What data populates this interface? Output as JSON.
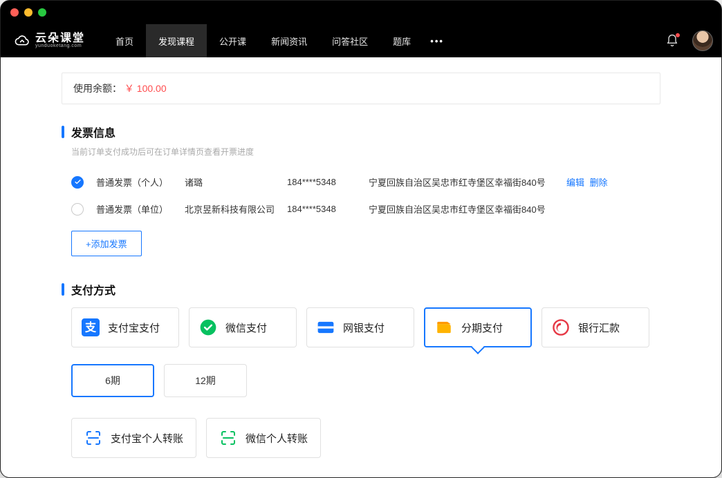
{
  "brand": {
    "name": "云朵课堂",
    "domain": "yunduoketang.com"
  },
  "nav": {
    "items": [
      {
        "label": "首页",
        "active": false
      },
      {
        "label": "发现课程",
        "active": true
      },
      {
        "label": "公开课",
        "active": false
      },
      {
        "label": "新闻资讯",
        "active": false
      },
      {
        "label": "问答社区",
        "active": false
      },
      {
        "label": "题库",
        "active": false
      }
    ]
  },
  "balance": {
    "label": "使用余额：",
    "value": "￥ 100.00"
  },
  "invoice": {
    "title": "发票信息",
    "sub": "当前订单支付成功后可在订单详情页查看开票进度",
    "rows": [
      {
        "type": "普通发票（个人）",
        "name": "诸璐",
        "phone": "184****5348",
        "addr": "宁夏回族自治区吴忠市红寺堡区幸福街840号",
        "checked": true,
        "actions": {
          "edit": "编辑",
          "del": "删除"
        }
      },
      {
        "type": "普通发票（单位）",
        "name": "北京昱新科技有限公司",
        "phone": "184****5348",
        "addr": "宁夏回族自治区吴忠市红寺堡区幸福街840号",
        "checked": false
      }
    ],
    "add": "+添加发票"
  },
  "payment": {
    "title": "支付方式",
    "methods": [
      {
        "label": "支付宝支付",
        "icon": "alipay",
        "selected": false
      },
      {
        "label": "微信支付",
        "icon": "wechat",
        "selected": false
      },
      {
        "label": "网银支付",
        "icon": "unionpay",
        "selected": false
      },
      {
        "label": "分期支付",
        "icon": "installment",
        "selected": true
      },
      {
        "label": "银行汇款",
        "icon": "bank",
        "selected": false
      }
    ],
    "installments": [
      {
        "label": "6期",
        "selected": true
      },
      {
        "label": "12期",
        "selected": false
      }
    ],
    "transfers": [
      {
        "label": "支付宝个人转账",
        "color": "#1677ff"
      },
      {
        "label": "微信个人转账",
        "color": "#07c160"
      }
    ]
  }
}
